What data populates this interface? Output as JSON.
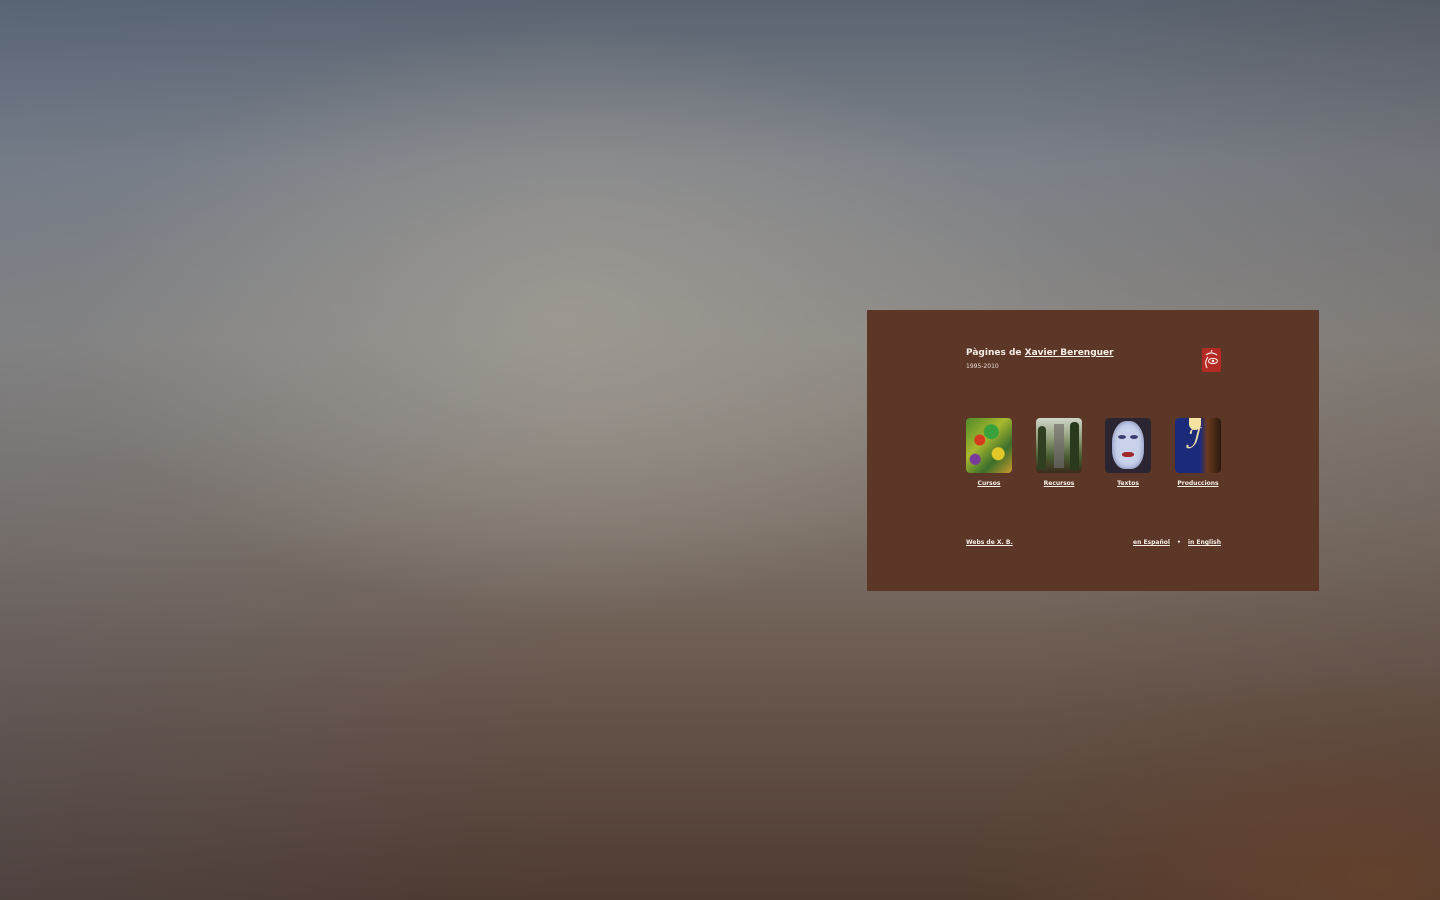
{
  "header": {
    "prefix": "Pàgines de",
    "author_link": "Xavier Berenguer",
    "years": "1995-2010"
  },
  "logo": {
    "icon": "eye-logo-icon",
    "color": "#b42a24"
  },
  "sections": [
    {
      "label": "Cursos",
      "icon": "cursos-thumbnail"
    },
    {
      "label": "Recursos",
      "icon": "recursos-thumbnail"
    },
    {
      "label": "Textos",
      "icon": "textos-thumbnail"
    },
    {
      "label": "Produccions",
      "icon": "produccions-thumbnail"
    }
  ],
  "footer": {
    "webs_link": "Webs de X. B.",
    "spanish_link": "en Español",
    "separator": "•",
    "english_link": "in English"
  },
  "colors": {
    "panel_background": "#5c3727",
    "text": "#f1e7df"
  }
}
